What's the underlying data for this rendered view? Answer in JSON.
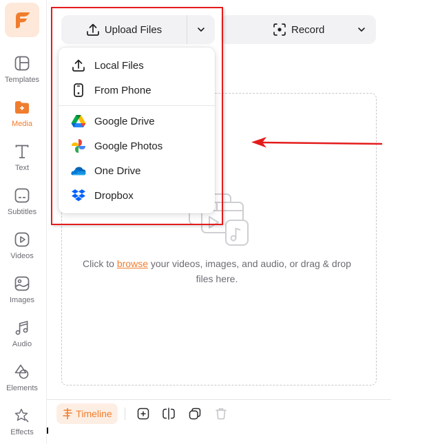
{
  "app": {
    "logo_letter": "F",
    "accent_color": "#f07d2e",
    "annotation_color": "#e41b1b"
  },
  "sidebar": {
    "items": [
      {
        "id": "templates",
        "label": "Templates",
        "icon": "templates-icon",
        "active": false
      },
      {
        "id": "media",
        "label": "Media",
        "icon": "media-folder-icon",
        "active": true
      },
      {
        "id": "text",
        "label": "Text",
        "icon": "text-icon",
        "active": false
      },
      {
        "id": "subtitles",
        "label": "Subtitles",
        "icon": "subtitles-icon",
        "active": false
      },
      {
        "id": "videos",
        "label": "Videos",
        "icon": "video-play-icon",
        "active": false
      },
      {
        "id": "images",
        "label": "Images",
        "icon": "image-icon",
        "active": false
      },
      {
        "id": "audio",
        "label": "Audio",
        "icon": "music-note-icon",
        "active": false
      },
      {
        "id": "elements",
        "label": "Elements",
        "icon": "shapes-icon",
        "active": false
      },
      {
        "id": "effects",
        "label": "Effects",
        "icon": "star-wand-icon",
        "active": false
      }
    ]
  },
  "toolbar": {
    "upload_label": "Upload Files",
    "record_label": "Record"
  },
  "upload_menu": {
    "items": [
      {
        "label": "Local Files",
        "icon": "upload-icon"
      },
      {
        "label": "From Phone",
        "icon": "phone-icon"
      },
      {
        "label": "Google Drive",
        "icon": "google-drive-icon"
      },
      {
        "label": "Google Photos",
        "icon": "google-photos-icon"
      },
      {
        "label": "One Drive",
        "icon": "onedrive-icon"
      },
      {
        "label": "Dropbox",
        "icon": "dropbox-icon"
      }
    ]
  },
  "dropzone": {
    "text_before": "Click to ",
    "link_text": "browse",
    "text_after": " your videos, images, and audio, or drag & drop files here."
  },
  "bottom_toolbar": {
    "timeline_label": "Timeline",
    "tools": [
      {
        "name": "add-track",
        "icon": "add-square-icon"
      },
      {
        "name": "split",
        "icon": "split-icon"
      },
      {
        "name": "duplicate",
        "icon": "duplicate-icon"
      },
      {
        "name": "delete",
        "icon": "trash-icon",
        "disabled": true
      }
    ]
  }
}
